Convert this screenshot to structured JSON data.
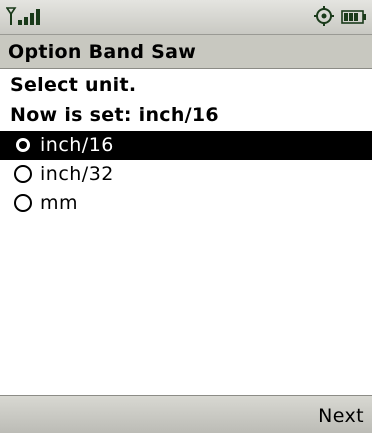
{
  "status_bar": {
    "signal_icon": "signal-strength-icon",
    "settings_icon": "settings-gear-icon",
    "battery_icon": "battery-icon"
  },
  "title_bar": {
    "title": "Option Band Saw"
  },
  "content": {
    "prompt": "Select unit.",
    "current": "Now is set: inch/16",
    "options": [
      {
        "label": "inch/16",
        "selected": true
      },
      {
        "label": "inch/32",
        "selected": false
      },
      {
        "label": "mm",
        "selected": false
      }
    ]
  },
  "softkeys": {
    "right": "Next"
  }
}
